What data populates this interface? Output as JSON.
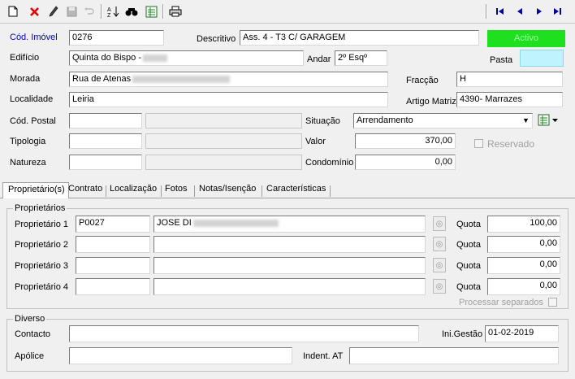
{
  "toolbar": {
    "buttons": [
      "new-document-icon",
      "delete-icon",
      "edit-icon",
      "save-icon",
      "undo-icon",
      "sort-icon",
      "find-icon",
      "report-icon",
      "print-icon"
    ],
    "nav": [
      "first-record-icon",
      "prev-record-icon",
      "next-record-icon",
      "last-record-icon"
    ]
  },
  "header": {
    "cod_imovel_label": "Cód. Imóvel",
    "cod_imovel": "0276",
    "descritivo_label": "Descritivo",
    "descritivo": "Ass. 4 - T3 C/ GARAGEM",
    "status": "Activo",
    "edificio_label": "Edifício",
    "edificio": "Quinta do Bispo -",
    "andar_label": "Andar",
    "andar": "2º Esqº",
    "pasta_label": "Pasta",
    "pasta": "",
    "morada_label": "Morada",
    "morada": "Rua de Atenas",
    "fraccao_label": "Fracção",
    "fraccao": "H",
    "localidade_label": "Localidade",
    "localidade": "Leiria",
    "artigo_label": "Artigo Matriz",
    "artigo": "4390- Marrazes",
    "cod_postal_label": "Cód. Postal",
    "situacao_label": "Situação",
    "situacao": "Arrendamento",
    "tipologia_label": "Tipologia",
    "valor_label": "Valor",
    "valor": "370,00",
    "reservado_label": "Reservado",
    "natureza_label": "Natureza",
    "condominio_label": "Condomínio",
    "condominio": "0,00"
  },
  "tabs": [
    "Proprietário(s)",
    "Contrato",
    "Localização",
    "Fotos",
    "Notas/Isenção",
    "Características"
  ],
  "owners": {
    "legend": "Proprietários",
    "quota_label": "Quota",
    "rows": [
      {
        "label": "Proprietário 1",
        "code": "P0027",
        "name": "JOSE DI",
        "quota": "100,00"
      },
      {
        "label": "Proprietário 2",
        "code": "",
        "name": "",
        "quota": "0,00"
      },
      {
        "label": "Proprietário 3",
        "code": "",
        "name": "",
        "quota": "0,00"
      },
      {
        "label": "Proprietário 4",
        "code": "",
        "name": "",
        "quota": "0,00"
      }
    ],
    "processar_label": "Processar separados"
  },
  "diverso": {
    "legend": "Diverso",
    "contacto_label": "Contacto",
    "contacto": "",
    "ini_gestao_label": "Ini.Gestão",
    "ini_gestao": "01-02-2019",
    "apolice_label": "Apólice",
    "apolice": "",
    "indent_label": "Indent. AT",
    "indent": ""
  },
  "colors": {
    "status_bg": "#1ee01e",
    "status_text": "#a8f7a8",
    "pasta_bg": "#bff4ff",
    "link_label": "#0000c8"
  }
}
